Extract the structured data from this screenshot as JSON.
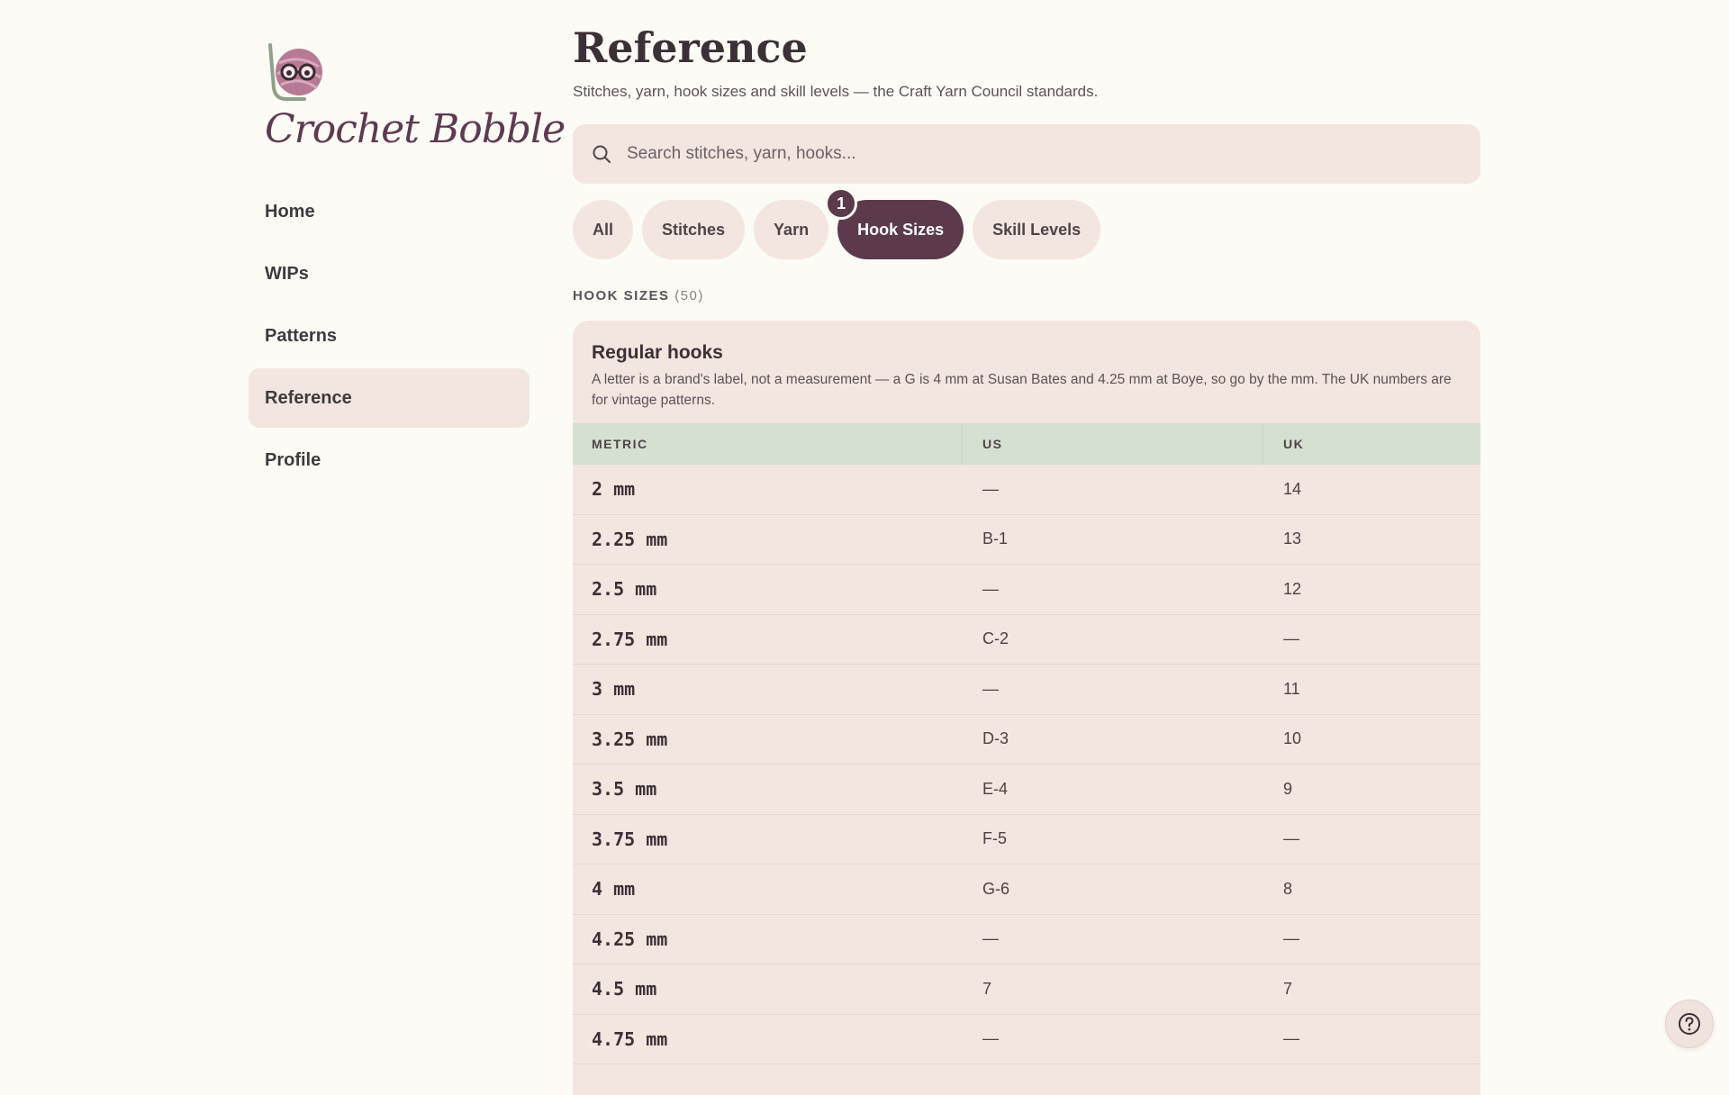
{
  "brand": {
    "name": "Crochet Bobble"
  },
  "nav": {
    "items": [
      {
        "label": "Home",
        "active": false
      },
      {
        "label": "WIPs",
        "active": false
      },
      {
        "label": "Patterns",
        "active": false
      },
      {
        "label": "Reference",
        "active": true
      },
      {
        "label": "Profile",
        "active": false
      }
    ]
  },
  "page": {
    "title": "Reference",
    "subtitle": "Stitches, yarn, hook sizes and skill levels — the Craft Yarn Council standards."
  },
  "search": {
    "placeholder": "Search stitches, yarn, hooks..."
  },
  "filters": {
    "chips": [
      {
        "label": "All",
        "active": false
      },
      {
        "label": "Stitches",
        "active": false
      },
      {
        "label": "Yarn",
        "active": false
      },
      {
        "label": "Hook Sizes",
        "active": true,
        "badge": "1"
      },
      {
        "label": "Skill Levels",
        "active": false
      }
    ]
  },
  "section": {
    "label": "HOOK SIZES",
    "count": "(50)"
  },
  "card": {
    "title": "Regular hooks",
    "description": "A letter is a brand's label, not a measurement — a G is 4 mm at Susan Bates and 4.25 mm at Boye, so go by the mm. The UK numbers are for vintage patterns.",
    "columns": [
      "METRIC",
      "US",
      "UK"
    ],
    "rows": [
      [
        "2 mm",
        "—",
        "14"
      ],
      [
        "2.25 mm",
        "B-1",
        "13"
      ],
      [
        "2.5 mm",
        "—",
        "12"
      ],
      [
        "2.75 mm",
        "C-2",
        "—"
      ],
      [
        "3 mm",
        "—",
        "11"
      ],
      [
        "3.25 mm",
        "D-3",
        "10"
      ],
      [
        "3.5 mm",
        "E-4",
        "9"
      ],
      [
        "3.75 mm",
        "F-5",
        "—"
      ],
      [
        "4 mm",
        "G-6",
        "8"
      ],
      [
        "4.25 mm",
        "—",
        "—"
      ],
      [
        "4.5 mm",
        "7",
        "7"
      ],
      [
        "4.75 mm",
        "—",
        "—"
      ]
    ]
  },
  "colors": {
    "background": "#fdfbf6",
    "surface": "#f3e6e0",
    "accent": "#5c3a4c",
    "table_header": "#d5e0d0"
  },
  "icons": {
    "search": "search-icon",
    "help": "help-icon",
    "logo": "yarn-ball-logo-icon"
  }
}
